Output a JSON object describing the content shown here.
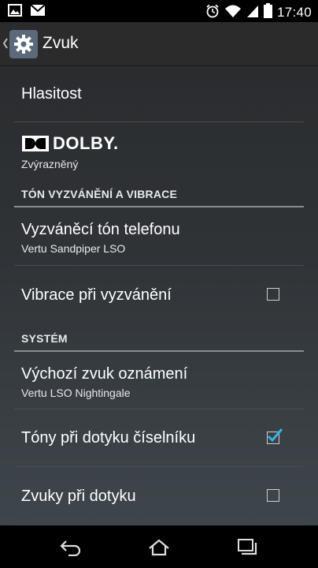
{
  "status_bar": {
    "time": "17:40"
  },
  "action_bar": {
    "title": "Zvuk"
  },
  "items": {
    "volume": {
      "title": "Hlasitost"
    },
    "dolby": {
      "logo_text": "DOLBY.",
      "subtitle": "Zvýrazněný"
    },
    "section_ringtone": {
      "label": "TÓN VYZVÁNĚNÍ A VIBRACE"
    },
    "ringtone": {
      "title": "Vyzváněcí tón telefonu",
      "subtitle": "Vertu Sandpiper LSO"
    },
    "vibrate": {
      "title": "Vibrace při vyzvánění",
      "checked": false
    },
    "section_system": {
      "label": "SYSTÉM"
    },
    "notification": {
      "title": "Výchozí zvuk oznámení",
      "subtitle": "Vertu LSO Nightingale"
    },
    "dialpad_tones": {
      "title": "Tóny při dotyku číselníku",
      "checked": true
    },
    "touch_sounds": {
      "title": "Zvuky při dotyku",
      "checked": false
    }
  },
  "colors": {
    "accent": "#33b5e5",
    "background": "#2f3235"
  }
}
